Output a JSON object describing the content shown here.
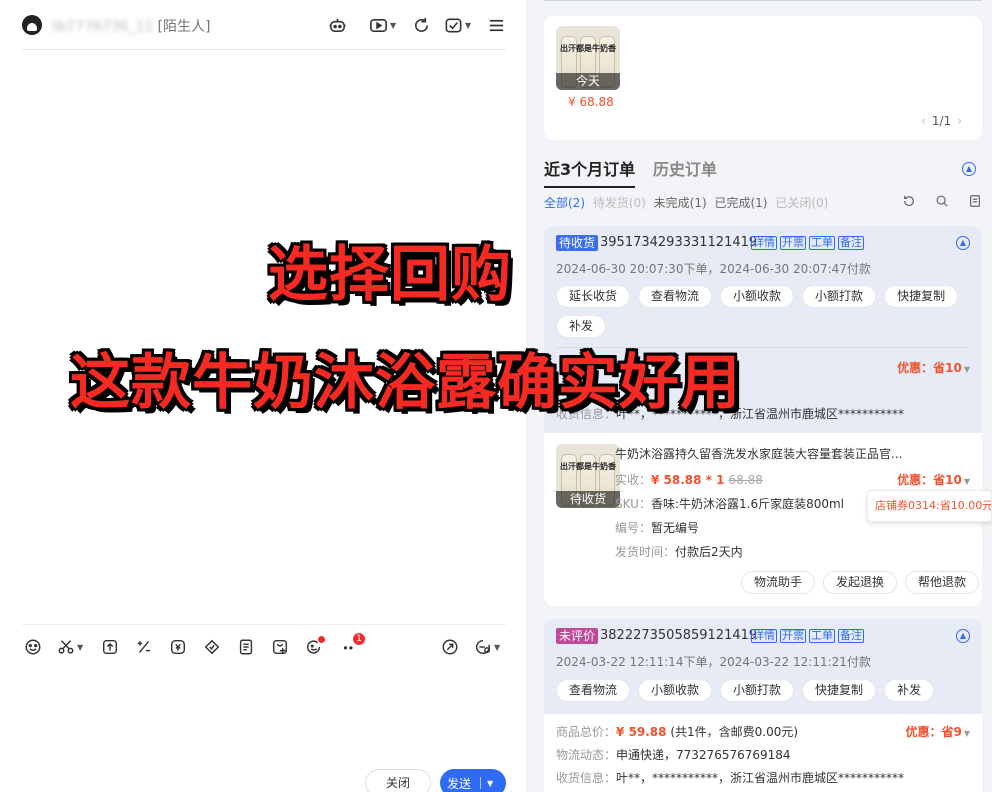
{
  "chat": {
    "user_name_masked": "tb7776736_11",
    "stranger_tag": "[陌生人]"
  },
  "buttons": {
    "close_label": "关闭",
    "send_label": "发送"
  },
  "toolbar": {
    "badge_count": "1"
  },
  "recent_product": {
    "thumb_text": "出汗都是牛奶香",
    "tag": "今天",
    "price": "¥ 68.88",
    "pager": "1/1"
  },
  "tabs": {
    "recent": "近3个月订单",
    "history": "历史订单"
  },
  "filters": [
    {
      "label": "全部(2)",
      "state": "active"
    },
    {
      "label": "待发货(0)",
      "state": "disabled"
    },
    {
      "label": "未完成(1)",
      "state": "normal"
    },
    {
      "label": "已完成(1)",
      "state": "normal"
    },
    {
      "label": "已关闭(0)",
      "state": "disabled"
    }
  ],
  "order_links": [
    "详情",
    "开票",
    "工单",
    "备注"
  ],
  "order1": {
    "status": "待收货",
    "status_color": "#3a6df0",
    "id": "3951734293331121419",
    "time": "2024-06-30 20:07:30下单，2024-06-30 20:07:47付款",
    "actions": [
      "延长收货",
      "查看物流",
      "小额收款",
      "小额打款",
      "快捷复制",
      "补发"
    ],
    "discount_total": "优惠：省10",
    "partial_line": "8",
    "receiver_label": "收货信息：",
    "receiver": "叶**，***********，浙江省温州市鹿城区***********",
    "goods": {
      "title": "牛奶沐浴露持久留香洗发水家庭装大容量套装正品官...",
      "paid_label": "实收：",
      "paid": "¥ 58.88 * 1",
      "original": "68.88",
      "discount": "优惠：省10",
      "sku_label": "SKU：",
      "sku": "香味:牛奶沐浴露1.6斤家庭装800ml",
      "code_label": "编号：",
      "code": "暂无编号",
      "ship_label": "发货时间：",
      "ship": "付款后2天内",
      "thumb_tag": "待收货"
    },
    "coupon_tip": "店铺券0314:省10.00元",
    "goods_actions": [
      "物流助手",
      "发起退换",
      "帮他退款"
    ]
  },
  "order2": {
    "status": "未评价",
    "status_color": "#c04a9a",
    "id": "3822273505859121419",
    "time": "2024-03-22 12:11:14下单，2024-03-22 12:11:21付款",
    "actions": [
      "查看物流",
      "小额收款",
      "小额打款",
      "快捷复制",
      "补发"
    ],
    "total_label": "商品总价：",
    "total": "¥ 59.88",
    "total_note": "(共1件，含邮费0.00元)",
    "discount": "优惠：省9",
    "logistics_label": "物流动态：",
    "logistics": "申通快递，773276576769184",
    "receiver_label": "收货信息：",
    "receiver": "叶**，***********，浙江省温州市鹿城区***********"
  },
  "captions": {
    "line1": "选择回购",
    "line2": "这款牛奶沐浴露确实好用"
  }
}
